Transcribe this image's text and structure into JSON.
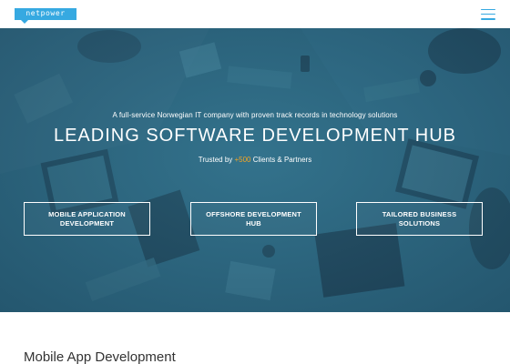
{
  "header": {
    "logo_text": "netpower",
    "menu_icon": "hamburger-menu-icon"
  },
  "hero": {
    "tagline": "A full-service Norwegian IT company with proven track records in technology solutions",
    "title": "LEADING SOFTWARE DEVELOPMENT HUB",
    "trusted_prefix": "Trusted by ",
    "trusted_count": "+500",
    "trusted_suffix": " Clients & Partners",
    "buttons": [
      {
        "line1": "MOBILE APPLICATION",
        "line2": "DEVELOPMENT"
      },
      {
        "line1": "OFFSHORE DEVELOPMENT",
        "line2": "HUB"
      },
      {
        "line1": "TAILORED BUSINESS",
        "line2": "SOLUTIONS"
      }
    ]
  },
  "section": {
    "title": "Mobile App Development"
  },
  "colors": {
    "brand": "#36a9e1",
    "accent": "#f5a623",
    "hero_tint": "#2b6681"
  }
}
